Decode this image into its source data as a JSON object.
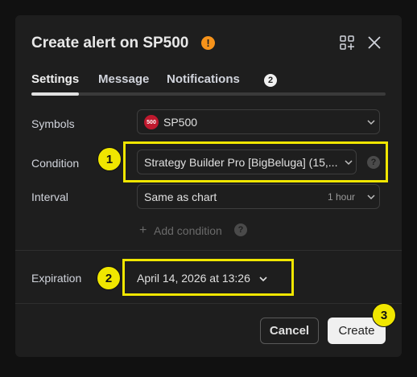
{
  "dialog": {
    "title": "Create alert on SP500",
    "warning_icon": "exclamation-warning-icon",
    "warning_glyph": "!",
    "header_icons": [
      "add-to-layout-icon",
      "close-icon"
    ]
  },
  "tabs": [
    {
      "label": "Settings",
      "active": true
    },
    {
      "label": "Message",
      "active": false
    },
    {
      "label": "Notifications",
      "active": false,
      "badge": "2"
    }
  ],
  "form": {
    "symbols": {
      "label": "Symbols",
      "logo_text": "500",
      "value": "SP500"
    },
    "condition": {
      "label": "Condition",
      "value": "Strategy Builder Pro [BigBeluga] (15,...",
      "help": "?"
    },
    "interval": {
      "label": "Interval",
      "value": "Same as chart",
      "hint": "1 hour"
    },
    "add_condition": {
      "plus": "+",
      "label": "Add condition",
      "help": "?"
    },
    "expiration": {
      "label": "Expiration",
      "value": "April 14, 2026 at 13:26"
    }
  },
  "buttons": {
    "cancel": "Cancel",
    "create": "Create"
  },
  "callouts": [
    "1",
    "2",
    "3"
  ],
  "colors": {
    "highlight": "#f0e600",
    "warning": "#f7931a",
    "symbol_logo": "#c0192e",
    "background": "#1e1e1e"
  }
}
